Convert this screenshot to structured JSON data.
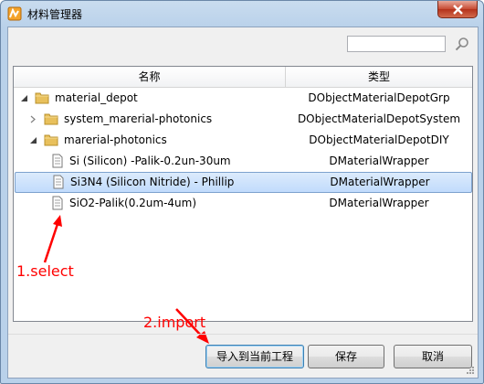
{
  "window": {
    "title": "材料管理器"
  },
  "search": {
    "value": "",
    "placeholder": ""
  },
  "tree": {
    "columns": {
      "name": "名称",
      "type": "类型"
    },
    "rows": [
      {
        "label": "material_depot",
        "type": "DObjectMaterialDepotGrp",
        "level": 0,
        "icon": "folder-icon",
        "expander": "expanded"
      },
      {
        "label": "system_marerial-photonics",
        "type": "DObjectMaterialDepotSystem",
        "level": 1,
        "icon": "folder-icon",
        "expander": "collapsed"
      },
      {
        "label": "marerial-photonics",
        "type": "DObjectMaterialDepotDIY",
        "level": 1,
        "icon": "folder-icon",
        "expander": "expanded"
      },
      {
        "label": "Si (Silicon) -Palik-0.2un-30um",
        "type": "DMaterialWrapper",
        "level": 2,
        "icon": "document-icon",
        "expander": "none"
      },
      {
        "label": "Si3N4 (Silicon Nitride) - Phillip",
        "type": "DMaterialWrapper",
        "level": 2,
        "icon": "document-icon",
        "expander": "none",
        "selected": true
      },
      {
        "label": "SiO2-Palik(0.2um-4um)",
        "type": "DMaterialWrapper",
        "level": 2,
        "icon": "document-icon",
        "expander": "none"
      }
    ]
  },
  "annotations": {
    "select": "1.select",
    "import": "2.import",
    "color": "#ff0000"
  },
  "buttons": {
    "import": "导入到当前工程",
    "save": "保存",
    "cancel": "取消"
  }
}
